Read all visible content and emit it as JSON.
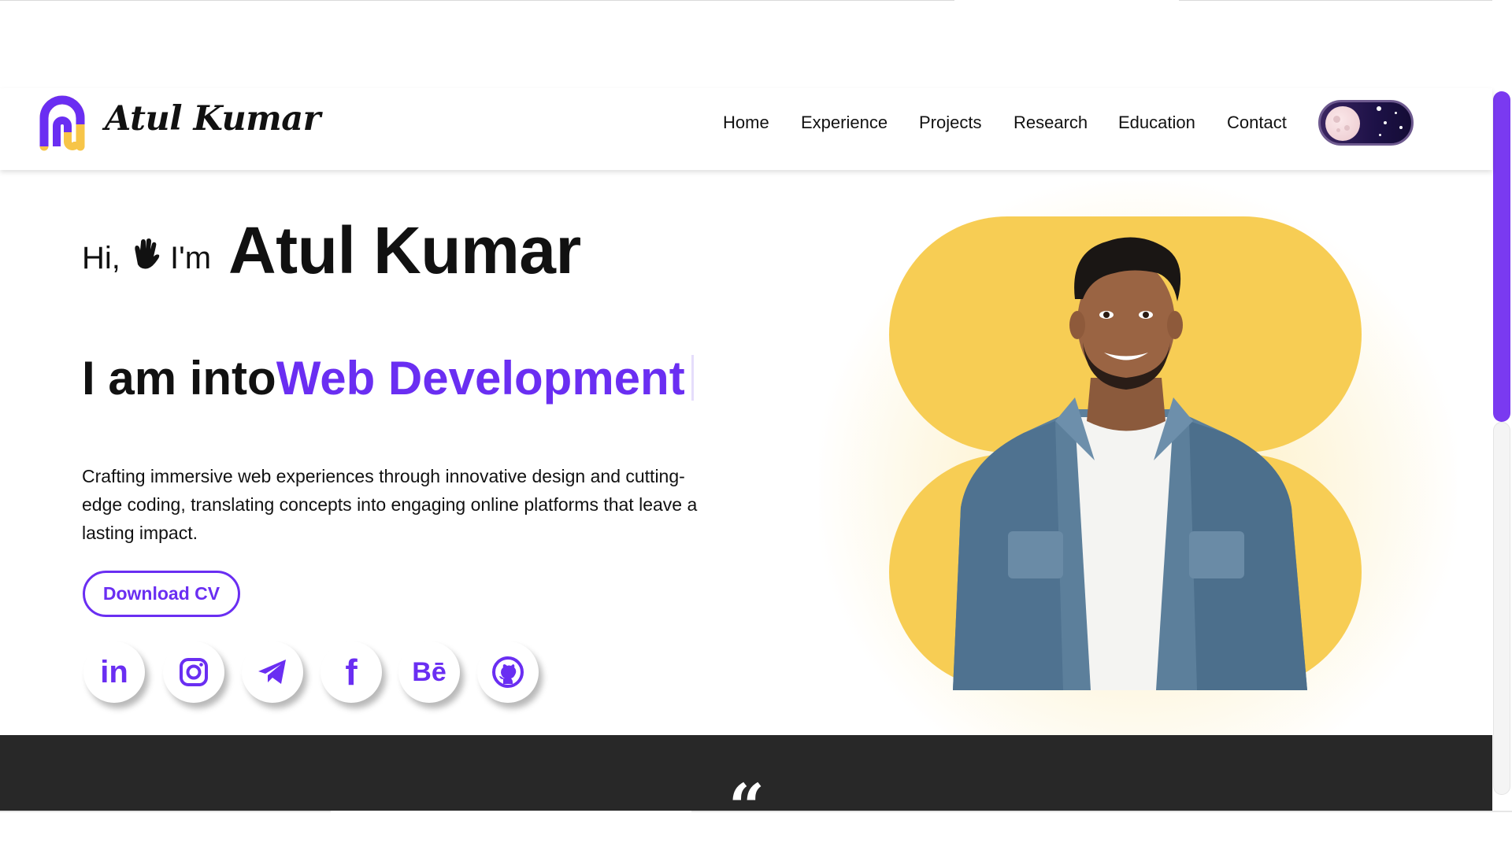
{
  "header": {
    "brand": "Atul Kumar",
    "nav": [
      {
        "label": "Home"
      },
      {
        "label": "Experience"
      },
      {
        "label": "Projects"
      },
      {
        "label": "Research"
      },
      {
        "label": "Education"
      },
      {
        "label": "Contact"
      }
    ],
    "theme_toggle": {
      "state": "dark",
      "icon": "moon-icon"
    }
  },
  "hero": {
    "greeting_hi": "Hi,",
    "greeting_im": "I'm",
    "name": "Atul Kumar",
    "tagline_prefix": "I am into",
    "tagline_highlight": "Web Development",
    "description": "Crafting immersive web experiences through innovative design and cutting-edge coding, translating concepts into engaging online platforms that leave a lasting impact.",
    "cta_label": "Download CV",
    "social": [
      {
        "icon": "linkedin-icon",
        "label": "in"
      },
      {
        "icon": "instagram-icon"
      },
      {
        "icon": "telegram-icon"
      },
      {
        "icon": "facebook-icon",
        "label": "f"
      },
      {
        "icon": "behance-icon",
        "label": "Bē"
      },
      {
        "icon": "github-icon"
      }
    ]
  },
  "quote_section": {
    "mark": "“"
  },
  "colors": {
    "accent": "#6a2ef2",
    "portrait_bg": "#f7cd54",
    "dark_section": "#282828",
    "logo_yellow": "#f7c548"
  }
}
